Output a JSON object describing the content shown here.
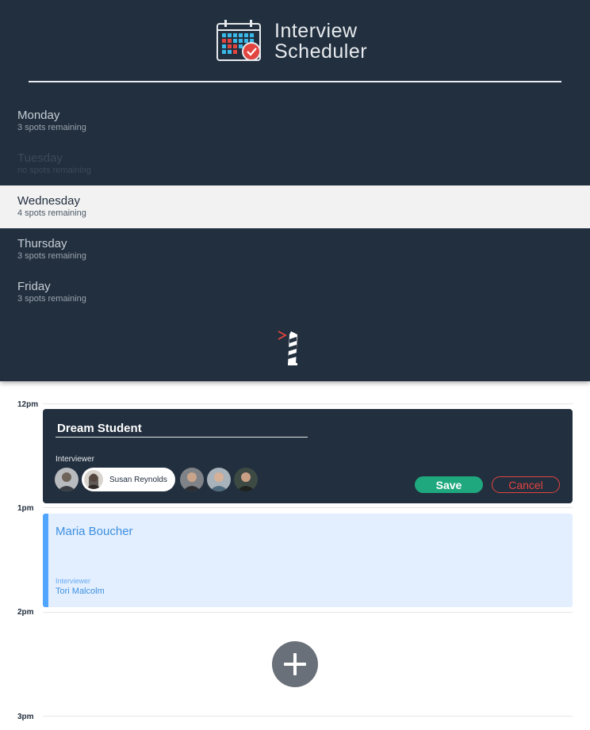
{
  "app": {
    "title_line1": "Interview",
    "title_line2": "Scheduler"
  },
  "days": [
    {
      "name": "Monday",
      "spots": "3 spots remaining",
      "state": "normal"
    },
    {
      "name": "Tuesday",
      "spots": "no spots remaining",
      "state": "full"
    },
    {
      "name": "Wednesday",
      "spots": "4 spots remaining",
      "state": "selected"
    },
    {
      "name": "Thursday",
      "spots": "3 spots remaining",
      "state": "normal"
    },
    {
      "name": "Friday",
      "spots": "3 spots remaining",
      "state": "normal"
    }
  ],
  "times": [
    "12pm",
    "1pm",
    "2pm",
    "3pm"
  ],
  "form": {
    "student_value": "Dream Student",
    "interviewer_label": "Interviewer",
    "selected_interviewer": "Susan Reynolds",
    "save_label": "Save",
    "cancel_label": "Cancel"
  },
  "appointment": {
    "student": "Maria Boucher",
    "interviewer_label": "Interviewer",
    "interviewer": "Tori Malcolm"
  },
  "colors": {
    "sidebar": "#222f3e",
    "save": "#1fa87e",
    "cancel": "#e2443f",
    "appointment_bg": "#e3efff",
    "appointment_accent": "#4fa5ff"
  },
  "icons": {
    "logo": "calendar-check-icon",
    "footer": "lighthouse-logo-icon",
    "add": "plus-icon"
  }
}
